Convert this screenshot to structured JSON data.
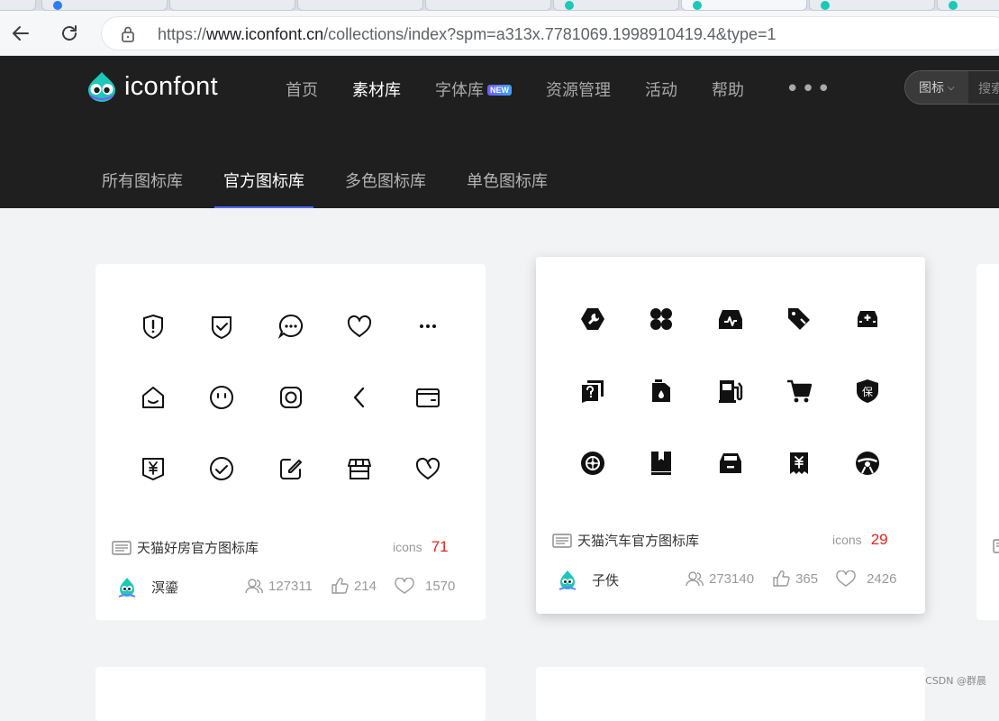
{
  "browser": {
    "url_prefix": "https://",
    "url_domain": "www.iconfont.cn",
    "url_path": "/collections/index?spm=a313x.7781069.1998910419.4&type=1"
  },
  "site": {
    "logo_text": "iconfont",
    "nav": [
      {
        "label": "首页"
      },
      {
        "label": "素材库",
        "active": true
      },
      {
        "label": "字体库",
        "badge": "NEW"
      },
      {
        "label": "资源管理"
      },
      {
        "label": "活动"
      },
      {
        "label": "帮助"
      }
    ],
    "more": "•••",
    "search": {
      "type_label": "图标",
      "placeholder": "搜索"
    },
    "subnav": [
      {
        "label": "所有图标库"
      },
      {
        "label": "官方图标库",
        "active": true
      },
      {
        "label": "多色图标库"
      },
      {
        "label": "单色图标库"
      }
    ]
  },
  "cards": [
    {
      "title": "天猫好房官方图标库",
      "icons_label": "icons",
      "icons_count": "71",
      "author": "溟鎏",
      "stats": {
        "users": "127311",
        "likes": "214",
        "favorites": "1570"
      },
      "icons": [
        "shield-exclamation-icon",
        "shield-check-icon",
        "chat-bubble-icon",
        "heart-outline-icon",
        "more-dots-icon",
        "house-smile-icon",
        "smile-face-icon",
        "rounded-square-circle-icon",
        "chevron-left-icon",
        "wallet-card-icon",
        "yuan-tag-icon",
        "check-circle-icon",
        "edit-square-icon",
        "storefront-icon",
        "heart-broken-icon"
      ]
    },
    {
      "title": "天猫汽车官方图标库",
      "icons_label": "icons",
      "icons_count": "29",
      "author": "子佚",
      "stats": {
        "users": "273140",
        "likes": "365",
        "favorites": "2426"
      },
      "icons": [
        "wrench-hexagon-icon",
        "four-leaf-icon",
        "car-pulse-icon",
        "tag-cut-icon",
        "car-medical-icon",
        "question-docs-icon",
        "oil-can-icon",
        "fuel-pump-icon",
        "shopping-cart-icon",
        "shield-bao-icon",
        "tire-wheel-icon",
        "manual-book-icon",
        "car-front-icon",
        "yuan-receipt-icon",
        "steering-wheel-icon"
      ]
    }
  ],
  "watermark": "CSDN @群晨"
}
